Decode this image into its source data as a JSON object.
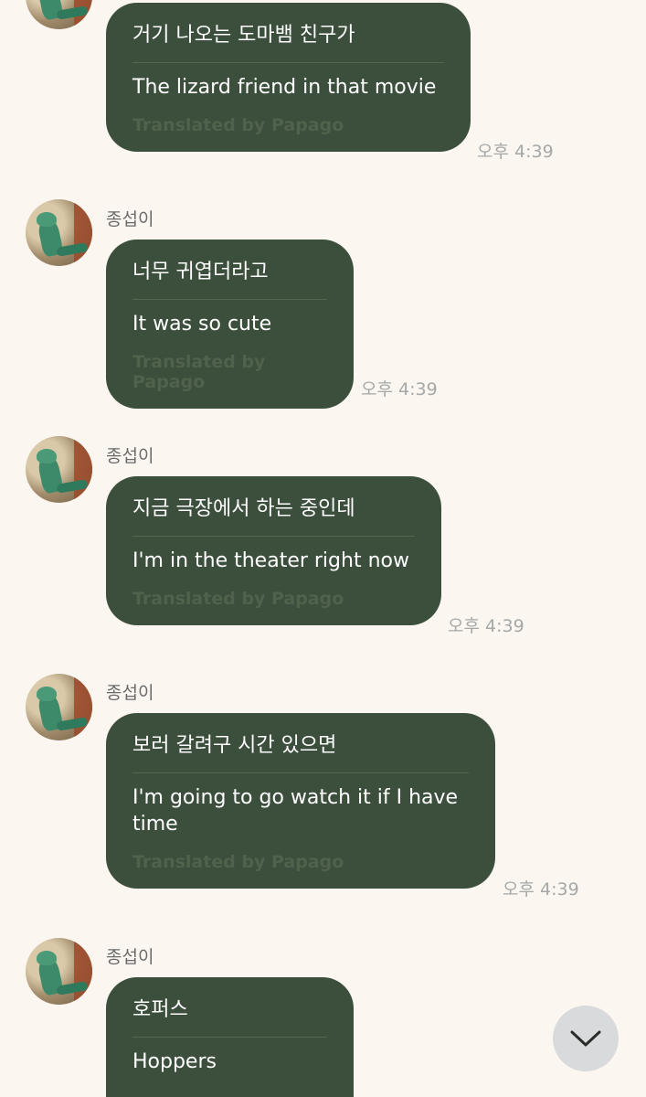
{
  "messages": [
    {
      "sender": "",
      "original": "거기 나오는 도마뱀 친구가",
      "translation": "The lizard friend in that movie",
      "credit": "Translated by Papago",
      "time": "오후 4:39"
    },
    {
      "sender": "종섭이",
      "original": "너무 귀엽더라고",
      "translation": "It was so cute",
      "credit": "Translated by Papago",
      "time": "오후 4:39"
    },
    {
      "sender": "종섭이",
      "original": "지금 극장에서 하는 중인데",
      "translation": "I'm in the theater right now",
      "credit": "Translated by Papago",
      "time": "오후 4:39"
    },
    {
      "sender": "종섭이",
      "original": "보러 갈려구 시간 있으면",
      "translation": "I'm going to go watch it if I have time",
      "credit": "Translated by Papago",
      "time": "오후 4:39"
    },
    {
      "sender": "종섭이",
      "original": "호퍼스",
      "translation": "Hoppers",
      "credit": "",
      "time": ""
    }
  ],
  "colors": {
    "background": "#fbf6f0",
    "bubble": "#3c4f3c",
    "timestamp": "#a5a8a7"
  },
  "icons": {
    "scroll_down": "chevron-down-icon"
  }
}
